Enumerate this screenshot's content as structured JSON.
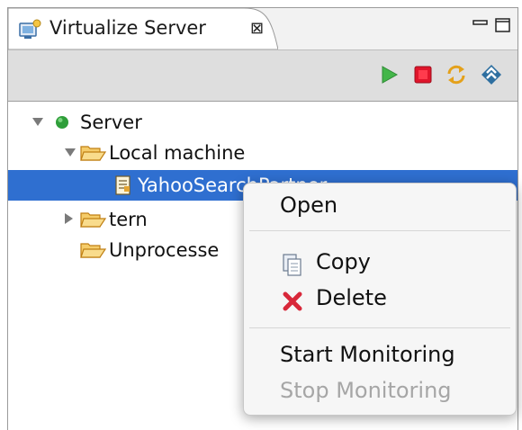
{
  "view": {
    "tab_title": "Virtualize Server",
    "tab_close_glyph": "⊠"
  },
  "toolbar": {
    "buttons": [
      {
        "name": "start-icon",
        "color": "#43b649"
      },
      {
        "name": "stop-icon",
        "color": "#e0152b"
      },
      {
        "name": "refresh-icon",
        "color": "#e4a11b"
      },
      {
        "name": "collapse-icon",
        "color": "#2e6fa0"
      }
    ]
  },
  "tree": {
    "items": [
      {
        "label": "Server",
        "icon": "status-green-icon",
        "expanded": true
      },
      {
        "label": "Local machine",
        "icon": "folder-open-icon",
        "expanded": true
      },
      {
        "label": "YahooSearchPartner",
        "icon": "document-icon",
        "selected": true
      },
      {
        "label": "tern",
        "icon": "folder-open-icon",
        "expanded": false
      },
      {
        "label": "Unprocesse",
        "icon": "folder-open-icon"
      }
    ]
  },
  "context_menu": {
    "items": [
      {
        "label": "Open",
        "enabled": true
      },
      {
        "label": "Copy",
        "icon": "copy-icon",
        "enabled": true
      },
      {
        "label": "Delete",
        "icon": "delete-icon",
        "enabled": true
      },
      {
        "label": "Start Monitoring",
        "enabled": true
      },
      {
        "label": "Stop Monitoring",
        "enabled": false
      }
    ]
  },
  "colors": {
    "selection": "#2f6fd0",
    "folder": "#e8a33a"
  }
}
